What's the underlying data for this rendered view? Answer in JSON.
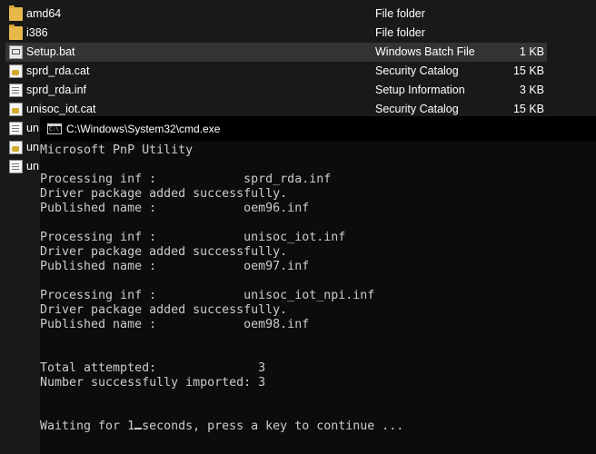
{
  "explorer": {
    "files": [
      {
        "icon": "folder-icon",
        "name": "amd64",
        "type": "File folder",
        "size": ""
      },
      {
        "icon": "folder-icon",
        "name": "i386",
        "type": "File folder",
        "size": ""
      },
      {
        "icon": "bat-file-icon",
        "name": "Setup.bat",
        "type": "Windows Batch File",
        "size": "1 KB",
        "selected": true
      },
      {
        "icon": "catalog-file-icon",
        "name": "sprd_rda.cat",
        "type": "Security Catalog",
        "size": "15 KB"
      },
      {
        "icon": "inf-file-icon",
        "name": "sprd_rda.inf",
        "type": "Setup Information",
        "size": "3 KB"
      },
      {
        "icon": "catalog-file-icon",
        "name": "unisoc_iot.cat",
        "type": "Security Catalog",
        "size": "15 KB"
      },
      {
        "icon": "inf-file-icon",
        "name": "un",
        "type": "",
        "size": ""
      },
      {
        "icon": "catalog-file-icon",
        "name": "un",
        "type": "",
        "size": ""
      },
      {
        "icon": "inf-file-icon",
        "name": "un",
        "type": "",
        "size": ""
      }
    ]
  },
  "cmd": {
    "title": "C:\\Windows\\System32\\cmd.exe",
    "icon_label": "C:\\",
    "lines": [
      "Microsoft PnP Utility",
      "",
      "Processing inf :            sprd_rda.inf",
      "Driver package added successfully.",
      "Published name :            oem96.inf",
      "",
      "Processing inf :            unisoc_iot.inf",
      "Driver package added successfully.",
      "Published name :            oem97.inf",
      "",
      "Processing inf :            unisoc_iot_npi.inf",
      "Driver package added successfully.",
      "Published name :            oem98.inf",
      "",
      "",
      "Total attempted:              3",
      "Number successfully imported: 3",
      "",
      ""
    ],
    "prompt_before": "Waiting for 1",
    "prompt_after": "seconds, press a key to continue ..."
  }
}
